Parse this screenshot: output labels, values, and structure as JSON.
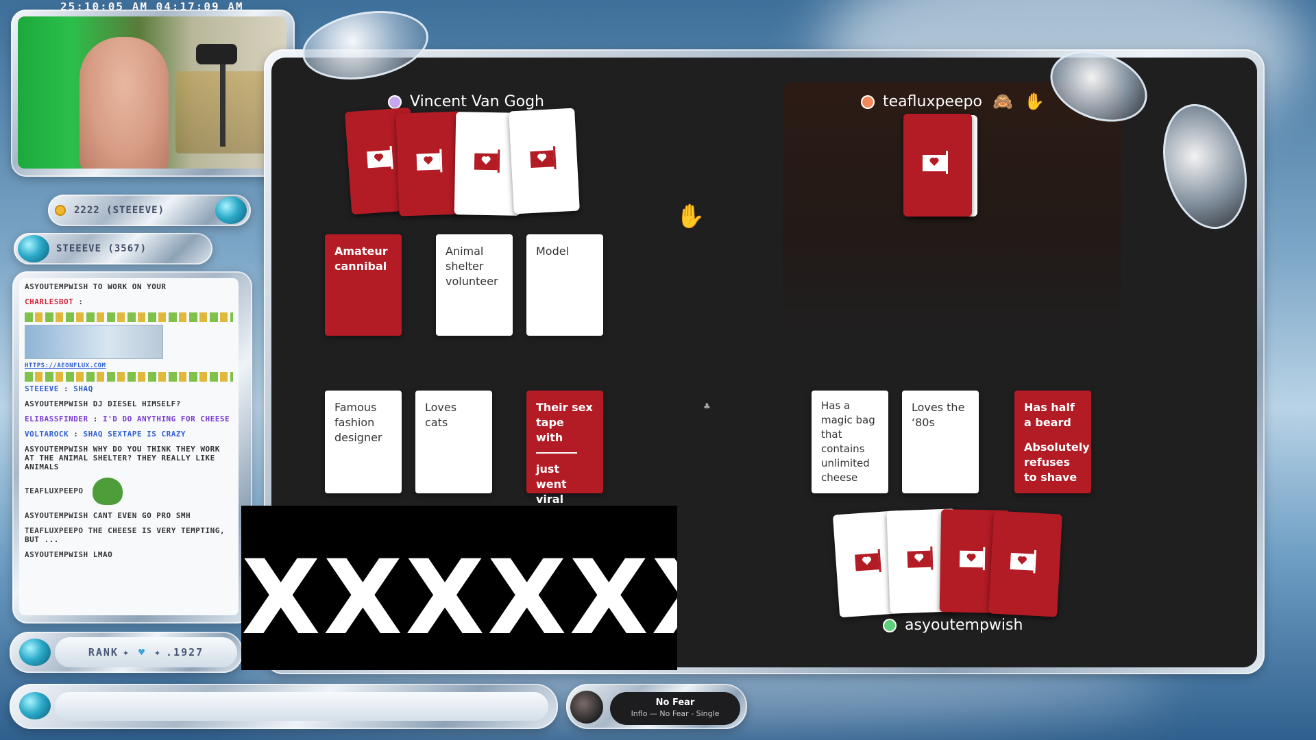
{
  "overlay": {
    "timestamp": "25:10:05 AM 04:17:09 AM",
    "points_label": "2222 (STEEEVE)",
    "sub_label": "STEEEVE (3567)",
    "rank_label": "RANK",
    "rank_value": ".1927"
  },
  "chat": {
    "messages": [
      {
        "user": "ASYOUTEMPWISH",
        "text": "TO WORK ON YOUR"
      },
      {
        "user": "CHARLESBOT",
        "text": ""
      },
      {
        "user": "",
        "text": "HTTPS://AEONFLUX.COM"
      },
      {
        "user": "STEEEVE",
        "text": "SHAQ"
      },
      {
        "user": "ASYOUTEMPWISH",
        "text": "DJ DIESEL HIMSELF?"
      },
      {
        "user": "ELIBASSFINDER",
        "text": "I'D DO ANYTHING FOR CHEESE"
      },
      {
        "user": "VOLTAROCK",
        "text": "SHAQ SEXTAPE IS CRAZY"
      },
      {
        "user": "ASYOUTEMPWISH",
        "text": "WHY DO YOU THINK THEY WORK AT THE ANIMAL SHELTER? THEY REALLY LIKE ANIMALS"
      },
      {
        "user": "TEAFLUXPEEPO",
        "text": ""
      },
      {
        "user": "ASYOUTEMPWISH",
        "text": "CANT EVEN GO PRO SMH"
      },
      {
        "user": "TEAFLUXPEEPO",
        "text": "THE CHEESE IS VERY TEMPTING, BUT ..."
      },
      {
        "user": "ASYOUTEMPWISH",
        "text": "LMAO"
      }
    ]
  },
  "music": {
    "title": "No Fear",
    "subtitle": "Inflo — No Fear - Single"
  },
  "game": {
    "players": {
      "top_left": "Vincent Van Gogh",
      "top_right": "teafluxpeepo",
      "bottom": "asyoutempwish"
    },
    "colors": {
      "top_left_dot": "#c9a7ee",
      "top_right_dot": "#f08a5d",
      "bottom_dot": "#5fd17a",
      "card_red": "#b31b25"
    },
    "row1_cards": [
      {
        "text": "Amateur cannibal",
        "color": "red"
      },
      {
        "text": "Animal shelter volunteer",
        "color": "white"
      },
      {
        "text": "Model",
        "color": "white"
      }
    ],
    "row2_left": [
      {
        "text": "Famous fashion designer",
        "color": "white"
      },
      {
        "text": "Loves cats",
        "color": "white"
      }
    ],
    "row2_red_card": {
      "line1": "Their sex tape with",
      "line2": "just went viral"
    },
    "row2_right": [
      {
        "text": "Has a magic bag that contains unlimited cheese",
        "color": "white"
      },
      {
        "text": "Loves the ‘80s",
        "color": "white"
      }
    ],
    "row2_right_red": {
      "line1": "Has half a beard",
      "line2": "Absolutely refuses to shave"
    },
    "censor_text": "XXXXXX",
    "icons": {
      "cursor": "hand-cursor-icon",
      "raise_hand": "raised-hand-icon",
      "monkey": "see-no-evil-monkey-icon"
    }
  }
}
